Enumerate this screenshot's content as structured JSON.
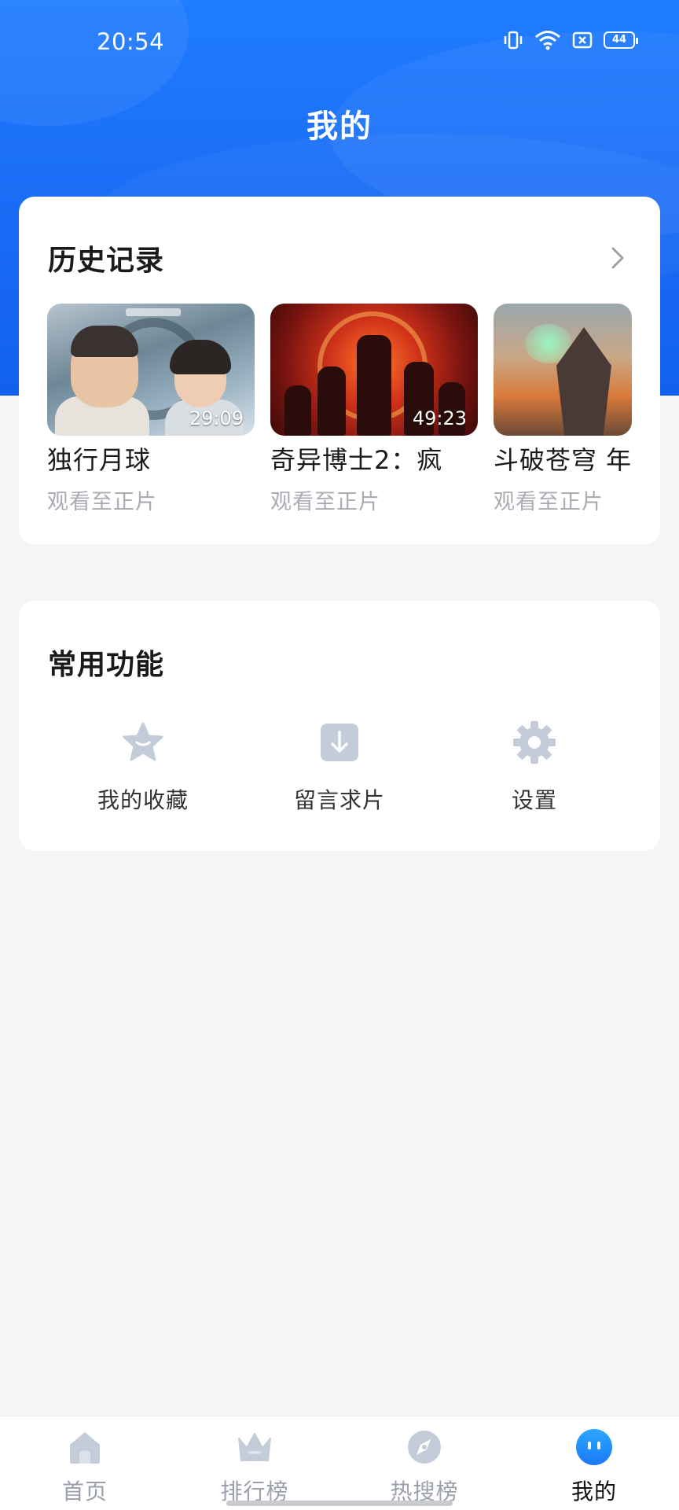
{
  "status_bar": {
    "time": "20:54",
    "battery": "44"
  },
  "page": {
    "title": "我的"
  },
  "history": {
    "title": "历史记录",
    "items": [
      {
        "title": "独行月球",
        "subtitle": "观看至正片",
        "duration": "29:09"
      },
      {
        "title": "奇异博士2：疯",
        "subtitle": "观看至正片",
        "duration": "49:23"
      },
      {
        "title": "斗破苍穹 年",
        "subtitle": "观看至正片",
        "duration": ""
      }
    ]
  },
  "functions": {
    "title": "常用功能",
    "items": [
      {
        "label": "我的收藏",
        "icon": "star-icon"
      },
      {
        "label": "留言求片",
        "icon": "download-icon"
      },
      {
        "label": "设置",
        "icon": "gear-icon"
      }
    ]
  },
  "bottom_nav": {
    "items": [
      {
        "label": "首页",
        "icon": "home-icon"
      },
      {
        "label": "排行榜",
        "icon": "crown-icon"
      },
      {
        "label": "热搜榜",
        "icon": "compass-icon"
      },
      {
        "label": "我的",
        "icon": "profile-face-icon"
      }
    ],
    "active": "我的"
  },
  "colors": {
    "header_blue": "#1a6bf5",
    "icon_gray": "#c5ccd9",
    "active_blue": "#1e90ff"
  }
}
